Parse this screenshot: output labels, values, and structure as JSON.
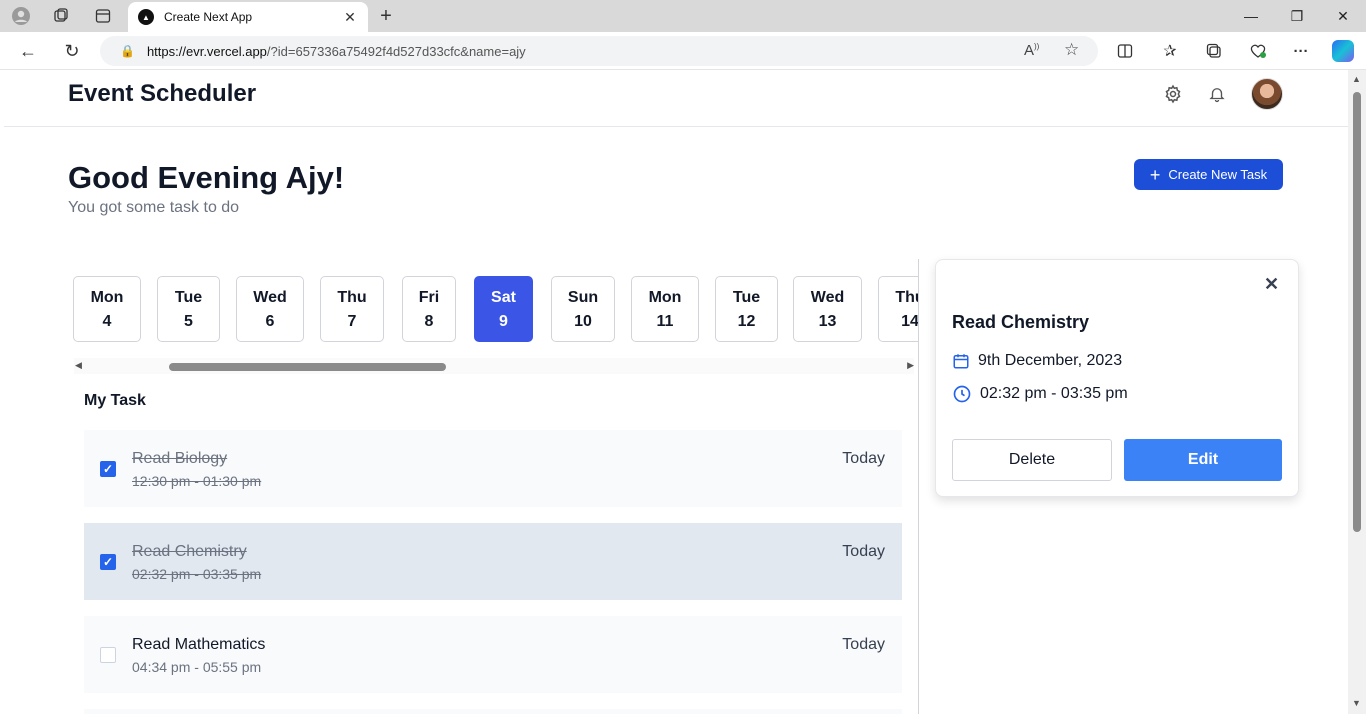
{
  "browser": {
    "tab_title": "Create Next App",
    "url_host": "https://evr.vercel.app",
    "url_path": "/?id=657336a75492f4d527d33cfc&name=ajy"
  },
  "header": {
    "brand": "Event Scheduler"
  },
  "greeting": {
    "title": "Good Evening Ajy!",
    "subtitle": "You got some task to do"
  },
  "create_button": {
    "label": "Create New Task"
  },
  "days": [
    {
      "name": "Mon",
      "date": "4"
    },
    {
      "name": "Tue",
      "date": "5"
    },
    {
      "name": "Wed",
      "date": "6"
    },
    {
      "name": "Thu",
      "date": "7"
    },
    {
      "name": "Fri",
      "date": "8"
    },
    {
      "name": "Sat",
      "date": "9",
      "selected": true
    },
    {
      "name": "Sun",
      "date": "10"
    },
    {
      "name": "Mon",
      "date": "11"
    },
    {
      "name": "Tue",
      "date": "12"
    },
    {
      "name": "Wed",
      "date": "13"
    },
    {
      "name": "Thu",
      "date": "14"
    }
  ],
  "my_task_label": "My Task",
  "tasks": [
    {
      "title": "Read Biology",
      "time": "12:30 pm - 01:30 pm",
      "when": "Today",
      "done": true
    },
    {
      "title": "Read Chemistry",
      "time": "02:32 pm - 03:35 pm",
      "when": "Today",
      "done": true
    },
    {
      "title": "Read Mathematics",
      "time": "04:34 pm - 05:55 pm",
      "when": "Today",
      "done": false
    }
  ],
  "detail": {
    "title": "Read Chemistry",
    "date": "9th December, 2023",
    "time": "02:32 pm - 03:35 pm",
    "delete_label": "Delete",
    "edit_label": "Edit"
  },
  "colors": {
    "primary": "#1d4ed8",
    "selected_day": "#3b55e6",
    "edit": "#3b82f6"
  }
}
